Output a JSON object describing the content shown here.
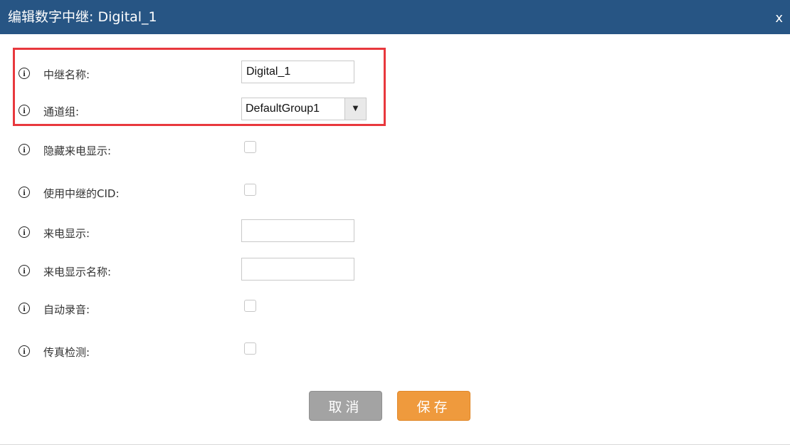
{
  "dialog": {
    "title": "编辑数字中继: Digital_1",
    "close_label": "x"
  },
  "icons": {
    "info": "info-icon",
    "dropdown": "triangle-down-icon",
    "info_glyph": "i",
    "dropdown_glyph": "▼"
  },
  "fields": {
    "trunk_name": {
      "label": "中继名称:",
      "value": "Digital_1"
    },
    "channel_group": {
      "label": "通道组:",
      "value": "DefaultGroup1"
    },
    "hide_caller_id": {
      "label": "隐藏来电显示:",
      "checked": false
    },
    "use_trunk_cid": {
      "label": "使用中继的CID:",
      "checked": false
    },
    "caller_id": {
      "label": "来电显示:",
      "value": ""
    },
    "caller_id_name": {
      "label": "来电显示名称:",
      "value": ""
    },
    "auto_record": {
      "label": "自动录音:",
      "checked": false
    },
    "fax_detect": {
      "label": "传真检测:",
      "checked": false
    }
  },
  "buttons": {
    "cancel": "取消",
    "save": "保存"
  },
  "colors": {
    "titlebar": "#275584",
    "highlight": "#e8383d",
    "cancel": "#a3a3a3",
    "save": "#ef9a3d"
  }
}
